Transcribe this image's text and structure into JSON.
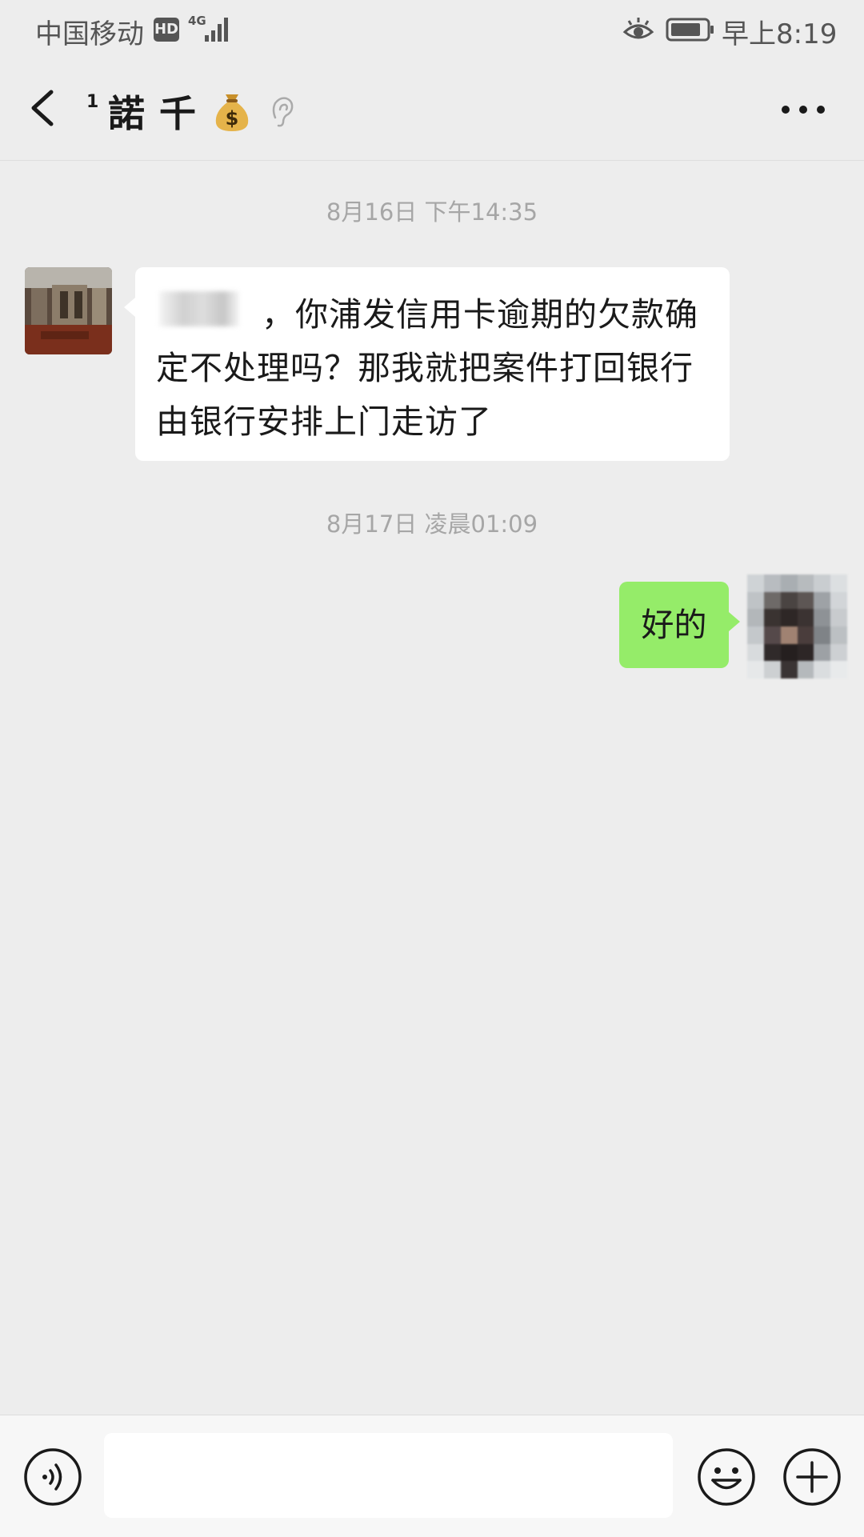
{
  "status_bar": {
    "carrier": "中国移动",
    "hd_badge": "HD",
    "network_type": "4G",
    "time": "早上8:19",
    "icons": [
      "eye-icon",
      "battery-icon",
      "signal-icon"
    ]
  },
  "header": {
    "title_prefix": "1",
    "title": "諾千",
    "icons": [
      "back-icon",
      "moneybag-icon",
      "ear-icon",
      "more-icon"
    ]
  },
  "chat": {
    "timestamp_1": "8月16日 下午14:35",
    "message_1": {
      "text": "，你浦发信用卡逾期的欠款确定不处理吗？那我就把案件打回银行由银行安排上门走访了"
    },
    "timestamp_2": "8月17日 凌晨01:09",
    "message_2": {
      "text": "好的"
    }
  },
  "input_bar": {
    "input_value": "",
    "icons": [
      "voice-icon",
      "emoji-icon",
      "plus-icon"
    ]
  },
  "colors": {
    "background": "#ededed",
    "sent_bubble": "#95ec69",
    "received_bubble": "#ffffff",
    "timestamp_text": "#a6a6a6"
  }
}
